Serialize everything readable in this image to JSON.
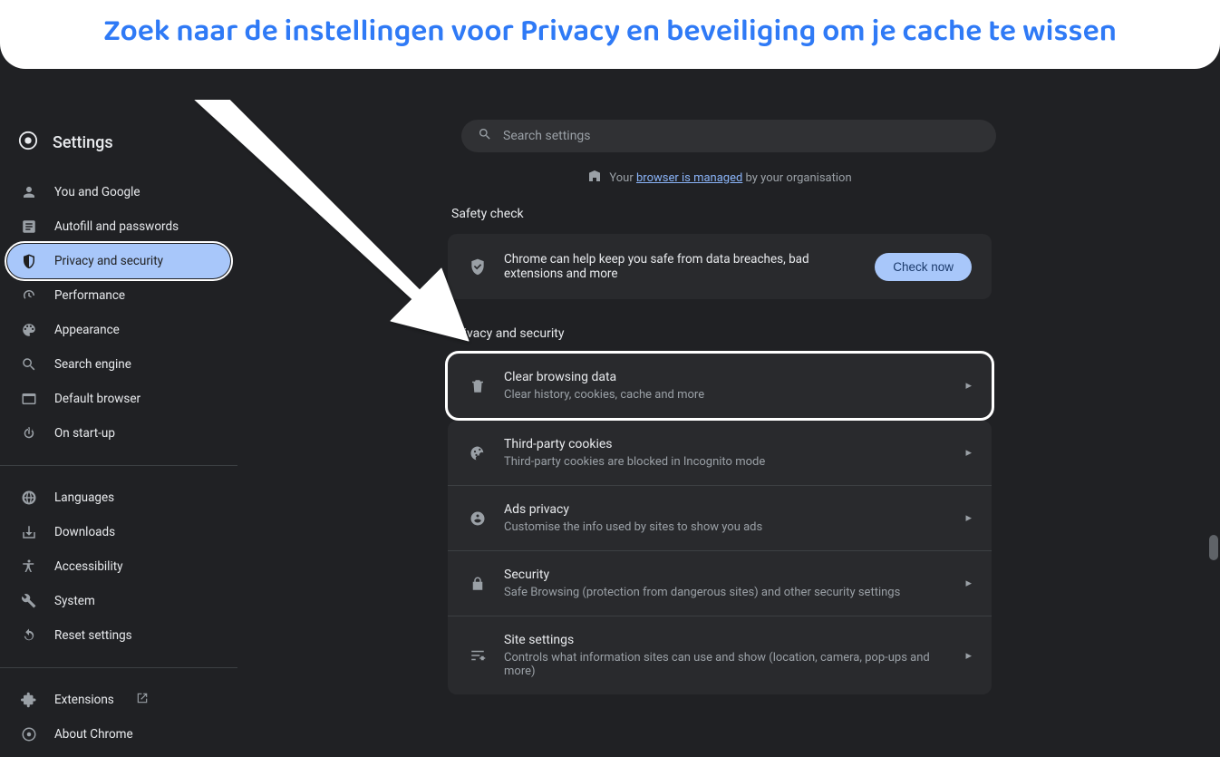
{
  "annotation": "Zoek naar de instellingen voor Privacy en beveiliging om je cache te wissen",
  "sidebar": {
    "title": "Settings",
    "items": [
      {
        "label": "You and Google"
      },
      {
        "label": "Autofill and passwords"
      },
      {
        "label": "Privacy and security"
      },
      {
        "label": "Performance"
      },
      {
        "label": "Appearance"
      },
      {
        "label": "Search engine"
      },
      {
        "label": "Default browser"
      },
      {
        "label": "On start-up"
      }
    ],
    "items2": [
      {
        "label": "Languages"
      },
      {
        "label": "Downloads"
      },
      {
        "label": "Accessibility"
      },
      {
        "label": "System"
      },
      {
        "label": "Reset settings"
      }
    ],
    "items3": [
      {
        "label": "Extensions"
      },
      {
        "label": "About Chrome"
      }
    ]
  },
  "search": {
    "placeholder": "Search settings"
  },
  "managed": {
    "prefix": "Your ",
    "link": "browser is managed",
    "suffix": " by your organisation"
  },
  "sections": {
    "safety_check": {
      "heading": "Safety check",
      "message": "Chrome can help keep you safe from data breaches, bad extensions and more",
      "button": "Check now"
    },
    "privacy": {
      "heading": "Privacy and security",
      "rows": [
        {
          "title": "Clear browsing data",
          "sub": "Clear history, cookies, cache and more"
        },
        {
          "title": "Third-party cookies",
          "sub": "Third-party cookies are blocked in Incognito mode"
        },
        {
          "title": "Ads privacy",
          "sub": "Customise the info used by sites to show you ads"
        },
        {
          "title": "Security",
          "sub": "Safe Browsing (protection from dangerous sites) and other security settings"
        },
        {
          "title": "Site settings",
          "sub": "Controls what information sites can use and show (location, camera, pop-ups and more)"
        }
      ]
    }
  }
}
